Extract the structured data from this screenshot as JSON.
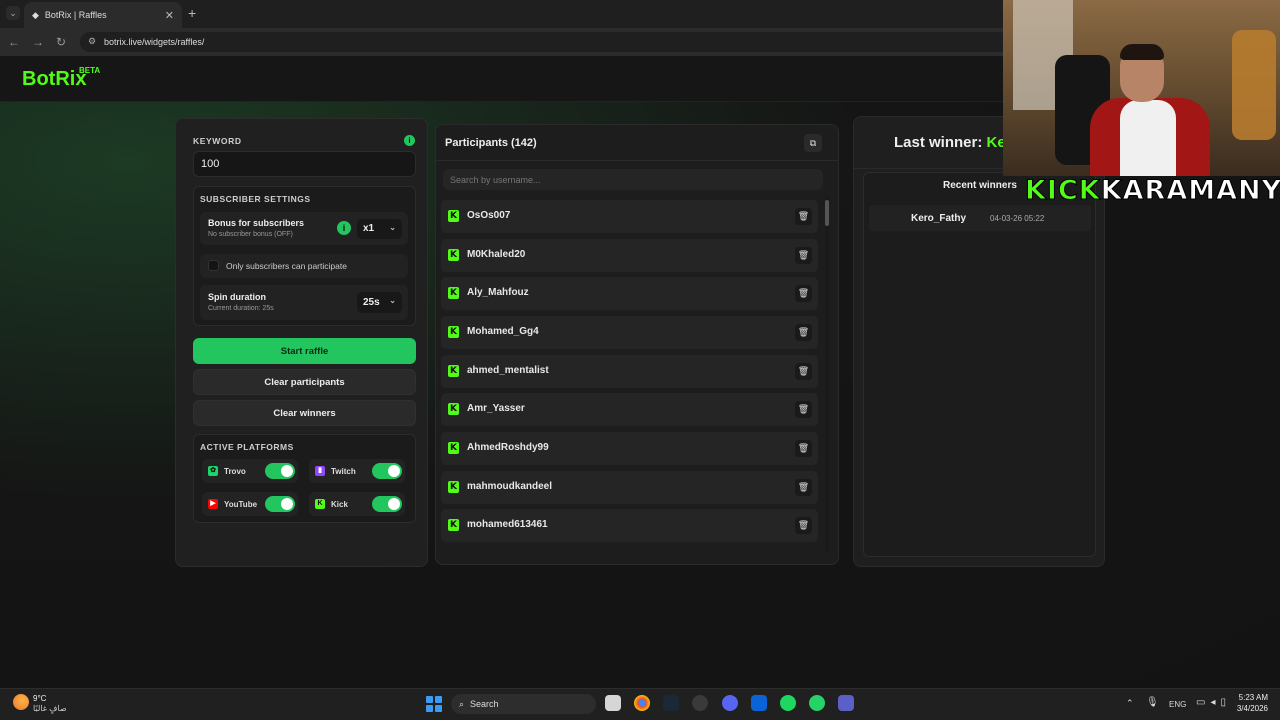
{
  "browser": {
    "tab_title": "BotRix | Raffles",
    "tab_close": "✕",
    "new_tab": "+",
    "url": "botrix.live/widgets/raffles/"
  },
  "app": {
    "logo": "BotRix",
    "logo_badge": "BETA"
  },
  "settings": {
    "keyword_label": "KEYWORD",
    "keyword_info": "i",
    "keyword_value": "100",
    "subscriber_settings_title": "SUBSCRIBER SETTINGS",
    "bonus_title": "Bonus for subscribers",
    "bonus_subtitle": "No subscriber bonus (OFF)",
    "bonus_info": "i",
    "bonus_multiplier": "x1",
    "only_subs_label": "Only subscribers can participate",
    "spin_title": "Spin duration",
    "spin_subtitle": "Current duration: 25s",
    "spin_value": "25s"
  },
  "actions": {
    "start": "Start raffle",
    "clear_participants": "Clear participants",
    "clear_winners": "Clear winners"
  },
  "platforms": {
    "title": "ACTIVE PLATFORMS",
    "items": [
      {
        "name": "Trovo",
        "enabled": true,
        "icon": "trovo-icon",
        "color": "#19d66b"
      },
      {
        "name": "Twitch",
        "enabled": true,
        "icon": "twitch-icon",
        "color": "#9146ff"
      },
      {
        "name": "YouTube",
        "enabled": true,
        "icon": "youtube-icon",
        "color": "#ff0000"
      },
      {
        "name": "Kick",
        "enabled": true,
        "icon": "kick-icon",
        "color": "#53fc18"
      }
    ]
  },
  "participants": {
    "title": "Participants (142)",
    "search_placeholder": "Search by username...",
    "list": [
      "OsOs007",
      "M0Khaled20",
      "Aly_Mahfouz",
      "Mohamed_Gg4",
      "ahmed_mentalist",
      "Amr_Yasser",
      "AhmedRoshdy99",
      "mahmoudkandeel",
      "mohamed613461"
    ]
  },
  "winner": {
    "last_label": "Last winner: ",
    "last_name": "Ke",
    "recent_title": "Recent winners",
    "recent": [
      {
        "name": "Kero_Fathy",
        "time": "04-03-26 05:22"
      }
    ]
  },
  "overlay": {
    "kick": "KICK",
    "streamer": "KARAMANY"
  },
  "taskbar": {
    "temp": "9°C",
    "weather": "صافٍ غالبًا",
    "search": "Search",
    "lang": "ENG",
    "time": "5:23 AM",
    "date": "3/4/2026"
  },
  "colors": {
    "accent": "#22c55e",
    "kick_green": "#53fc18"
  }
}
